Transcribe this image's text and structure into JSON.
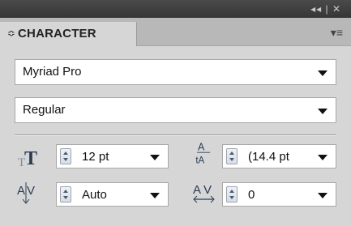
{
  "panel": {
    "title_controls": "◂◂ | ✕",
    "tab_arrow": "≎",
    "tab_label": "CHARACTER",
    "menu_icon": "▾≡"
  },
  "font_family": {
    "value": "Myriad Pro"
  },
  "font_style": {
    "value": "Regular"
  },
  "font_size": {
    "value": "12 pt"
  },
  "leading": {
    "value": "(14.4 pt"
  },
  "kerning": {
    "value": "Auto"
  },
  "tracking": {
    "value": "0"
  },
  "icons": {
    "font_size": "font-size-icon",
    "leading": "leading-icon",
    "kerning": "kerning-icon",
    "tracking": "tracking-icon"
  }
}
